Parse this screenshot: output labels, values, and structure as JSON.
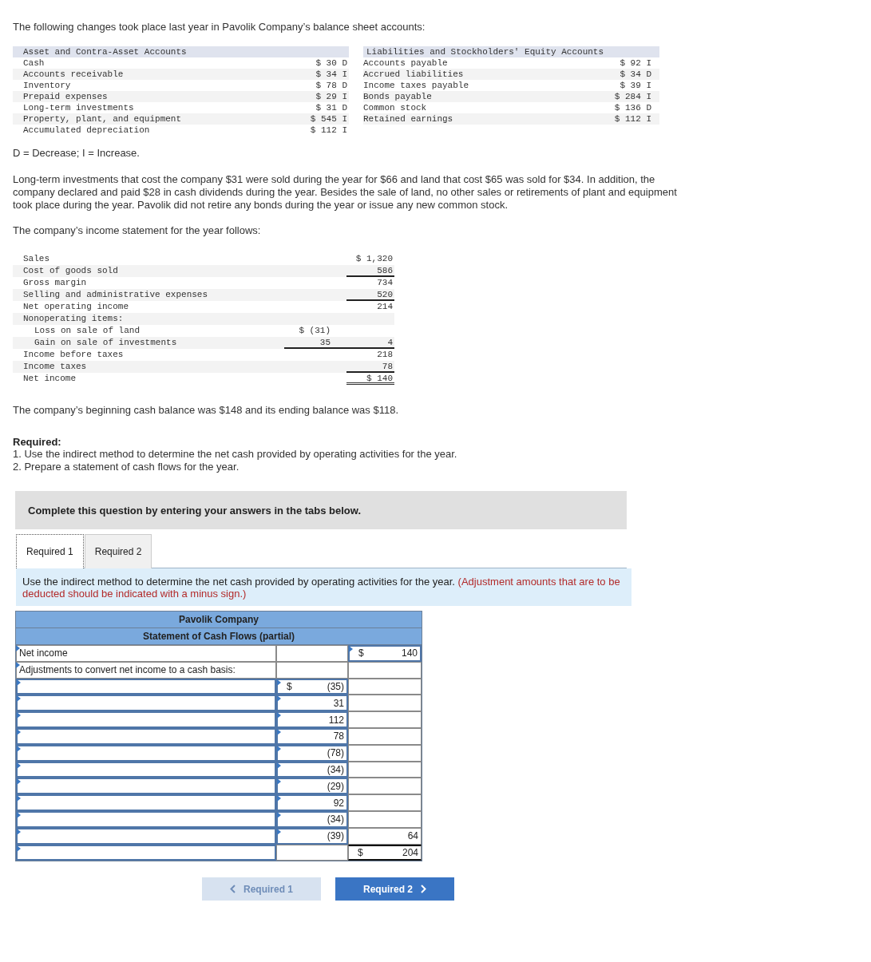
{
  "intro": "The following changes took place last year in Pavolik Company’s balance sheet accounts:",
  "balance_changes": {
    "left_heading": "Asset and Contra-Asset Accounts",
    "right_heading": "Liabilities and Stockholders' Equity Accounts",
    "left_rows": [
      {
        "account": "Cash",
        "change": "$ 30 D"
      },
      {
        "account": "Accounts receivable",
        "change": "$ 34 I"
      },
      {
        "account": "Inventory",
        "change": "$ 78 D"
      },
      {
        "account": "Prepaid expenses",
        "change": "$ 29 I"
      },
      {
        "account": "Long-term investments",
        "change": "$ 31 D"
      },
      {
        "account": "Property, plant, and equipment",
        "change": "$ 545 I"
      },
      {
        "account": "Accumulated depreciation",
        "change": "$ 112 I"
      }
    ],
    "right_rows": [
      {
        "account": "Accounts payable",
        "change": "$ 92 I"
      },
      {
        "account": "Accrued liabilities",
        "change": "$ 34 D"
      },
      {
        "account": "Income taxes payable",
        "change": "$ 39 I"
      },
      {
        "account": "Bonds payable",
        "change": "$ 284 I"
      },
      {
        "account": "Common stock",
        "change": "$ 136 D"
      },
      {
        "account": "Retained earnings",
        "change": "$ 112 I"
      }
    ]
  },
  "legend": "D = Decrease; I = Increase.",
  "paragraphs": [
    "Long-term investments that cost the company $31 were sold during the year for $66 and land that cost $65 was sold for $34. In addition, the company declared and paid $28 in cash dividends during the year. Besides the sale of land, no other sales or retirements of plant and equipment took place during the year. Pavolik did not retire any bonds during the year or issue any new common stock.",
    "The company’s income statement for the year follows:"
  ],
  "income_statement": [
    {
      "label": "Sales",
      "column_2": {
        "text": "$ 1,320"
      }
    },
    {
      "label": "Cost of goods sold",
      "column_2": {
        "text": "586",
        "underline": true
      }
    },
    {
      "label": "Gross margin",
      "column_2": {
        "text": "734"
      }
    },
    {
      "label": "Selling and administrative expenses",
      "column_2": {
        "text": "520",
        "underline": true
      }
    },
    {
      "label": "Net operating income",
      "column_2": {
        "text": "214"
      }
    },
    {
      "label": "Nonoperating items:",
      "children": [
        {
          "label": "Loss on sale of land",
          "column_1": {
            "text": "$ (31)"
          }
        },
        {
          "label": "Gain on sale of investments",
          "column_1": {
            "text": "35",
            "underline": true
          },
          "column_2": {
            "text": "4",
            "underline": true
          }
        }
      ]
    },
    {
      "label": "Income before taxes",
      "column_2": {
        "text": "218"
      }
    },
    {
      "label": "Income taxes",
      "column_2": {
        "text": "78",
        "underline": true
      }
    },
    {
      "label": "Net income",
      "column_2": {
        "text": "$ 140",
        "double_underline": true
      }
    }
  ],
  "cash_balance_note": "The company’s beginning cash balance was $148 and its ending balance was $118.",
  "required": {
    "heading": "Required:",
    "items": [
      "1. Use the indirect method to determine the net cash provided by operating activities for the year.",
      "2. Prepare a statement of cash flows for the year."
    ]
  },
  "prompt": "Complete this question by entering your answers in the tabs below.",
  "tabs": [
    {
      "label": "Required 1",
      "selected": true
    },
    {
      "label": "Required 2",
      "selected": false
    }
  ],
  "instruction": {
    "text": "Use the indirect method to determine the net cash provided by operating activities for the year.",
    "note": "(Adjustment amounts that are to be deducted should be indicated with a minus sign.)"
  },
  "cash_flow_table": {
    "title": "Pavolik Company",
    "subtitle": "Statement of Cash Flows (partial)",
    "rows": [
      {
        "label": {
          "kind": "filled",
          "value": "Net income"
        },
        "amount": {
          "kind": "text"
        },
        "total": {
          "kind": "input",
          "dollar": "$",
          "value": "140"
        }
      },
      {
        "label": {
          "kind": "filled",
          "value": "Adjustments to convert net income to a cash basis:"
        },
        "amount": {
          "kind": "text"
        },
        "total": {
          "kind": "text"
        }
      },
      {
        "label": {
          "kind": "input"
        },
        "amount": {
          "kind": "input",
          "dollar": "$",
          "value": "(35)"
        },
        "total": {
          "kind": "text"
        }
      },
      {
        "label": {
          "kind": "input"
        },
        "amount": {
          "kind": "input",
          "value": "31"
        },
        "total": {
          "kind": "text"
        }
      },
      {
        "label": {
          "kind": "input"
        },
        "amount": {
          "kind": "input",
          "value": "112"
        },
        "total": {
          "kind": "text"
        }
      },
      {
        "label": {
          "kind": "input"
        },
        "amount": {
          "kind": "input",
          "value": "78"
        },
        "total": {
          "kind": "text"
        }
      },
      {
        "label": {
          "kind": "input"
        },
        "amount": {
          "kind": "input",
          "value": "(78)"
        },
        "total": {
          "kind": "text"
        }
      },
      {
        "label": {
          "kind": "input"
        },
        "amount": {
          "kind": "input",
          "value": "(34)"
        },
        "total": {
          "kind": "text"
        }
      },
      {
        "label": {
          "kind": "input"
        },
        "amount": {
          "kind": "input",
          "value": "(29)"
        },
        "total": {
          "kind": "text"
        }
      },
      {
        "label": {
          "kind": "input"
        },
        "amount": {
          "kind": "input",
          "value": "92"
        },
        "total": {
          "kind": "text"
        }
      },
      {
        "label": {
          "kind": "input"
        },
        "amount": {
          "kind": "input",
          "value": "(34)"
        },
        "total": {
          "kind": "text"
        }
      },
      {
        "label": {
          "kind": "input"
        },
        "amount": {
          "kind": "input",
          "value": "(39)"
        },
        "total": {
          "kind": "text",
          "value": "64"
        }
      },
      {
        "label": {
          "kind": "input"
        },
        "amount": {
          "kind": "text"
        },
        "total": {
          "kind": "total",
          "dollar": "$",
          "value": "204"
        }
      }
    ]
  },
  "nav_buttons": [
    {
      "label": "Required 1",
      "kind": "back",
      "disabled": true
    },
    {
      "label": "Required 2",
      "kind": "next",
      "disabled": false
    }
  ]
}
